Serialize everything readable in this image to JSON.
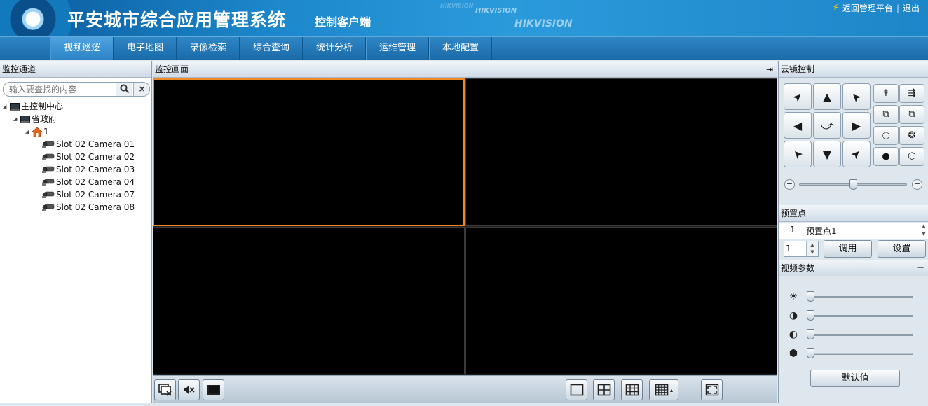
{
  "header": {
    "title": "平安城市综合应用管理系统",
    "subtitle": "控制客户端",
    "brand_small": "HIKVISION",
    "brand_large": "HIKVISION",
    "brand_faint": "HIKVISION",
    "return_link": "返回管理平台",
    "separator": "|",
    "logout_link": "退出"
  },
  "nav": {
    "tabs": [
      "视频巡逻",
      "电子地图",
      "录像检索",
      "综合查询",
      "统计分析",
      "运维管理",
      "本地配置"
    ],
    "active_index": 0
  },
  "left_panel": {
    "title": "监控通道",
    "search_placeholder": "输入要查找的内容",
    "tree": {
      "root": "主控制中心",
      "level1": "省政府",
      "level2": "1",
      "cameras": [
        "Slot 02 Camera 01",
        "Slot 02 Camera 02",
        "Slot 02 Camera 03",
        "Slot 02 Camera 04",
        "Slot 02 Camera 07",
        "Slot 02 Camera 08"
      ]
    }
  },
  "center_panel": {
    "title": "监控画面",
    "layout": "2x2",
    "selected_cell": 0
  },
  "right_panel": {
    "ptz_title": "云镜控制",
    "speed_level": 0.5,
    "preset_title": "预置点",
    "preset_list": [
      {
        "num": "1",
        "name": "预置点1"
      }
    ],
    "preset_input": "1",
    "call_button": "调用",
    "set_button": "设置",
    "video_params_title": "视频参数",
    "video_params_collapse": "−",
    "params": [
      {
        "name": "brightness",
        "icon": "sun-icon",
        "level": 0
      },
      {
        "name": "contrast",
        "icon": "contrast-icon",
        "level": 0
      },
      {
        "name": "saturation",
        "icon": "saturation-icon",
        "level": 0
      },
      {
        "name": "hue",
        "icon": "hue-icon",
        "level": 0
      }
    ],
    "default_button": "默认值"
  },
  "colors": {
    "header_blue": "#1d88cc",
    "selected_border": "#f08a24",
    "video_bg": "#000000",
    "lightning": "#ffd200"
  }
}
